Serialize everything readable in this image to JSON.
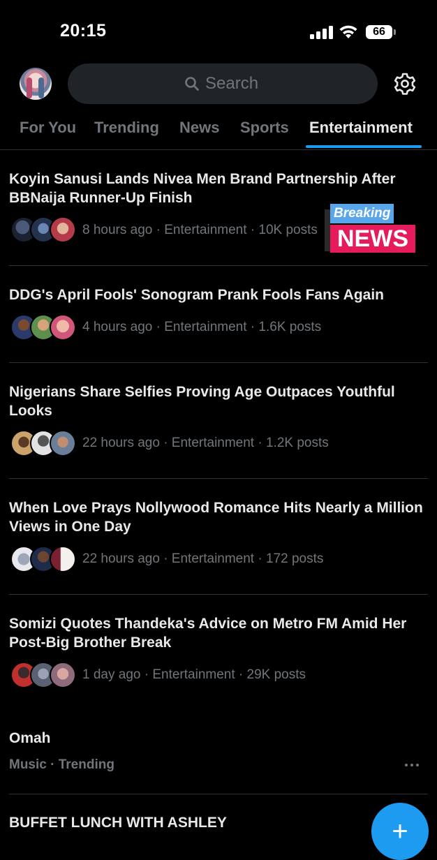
{
  "status_bar": {
    "time": "20:15",
    "battery": "66"
  },
  "header": {
    "search_placeholder": "Search"
  },
  "tabs": [
    {
      "label": "For You"
    },
    {
      "label": "Trending"
    },
    {
      "label": "News"
    },
    {
      "label": "Sports"
    },
    {
      "label": "Entertainment"
    }
  ],
  "active_tab": "Entertainment",
  "accent_color": "#1d9bf0",
  "stories": [
    {
      "title": "Koyin Sanusi Lands Nivea Men Brand Partnership After BBNaija Runner-Up Finish",
      "meta": "8 hours ago · Entertainment · 10K posts"
    },
    {
      "title": "DDG's April Fools' Sonogram Prank Fools Fans Again",
      "meta": "4 hours ago · Entertainment · 1.6K posts"
    },
    {
      "title": "Nigerians Share Selfies Proving Age Outpaces Youthful Looks",
      "meta": "22 hours ago · Entertainment · 1.2K posts"
    },
    {
      "title": "When Love Prays Nollywood Romance Hits Nearly a Million Views in One Day",
      "meta": "22 hours ago · Entertainment · 172 posts"
    },
    {
      "title": "Somizi Quotes Thandeka's Advice on Metro FM Amid Her Post-Big Brother Break",
      "meta": "1 day ago · Entertainment · 29K posts"
    }
  ],
  "breaking_badge": {
    "top": "Breaking",
    "bottom": "NEWS"
  },
  "trend": {
    "title": "Omah",
    "meta": "Music · Trending"
  },
  "next_item": {
    "title": "BUFFET LUNCH WITH ASHLEY"
  },
  "fab": {
    "label": "+"
  }
}
